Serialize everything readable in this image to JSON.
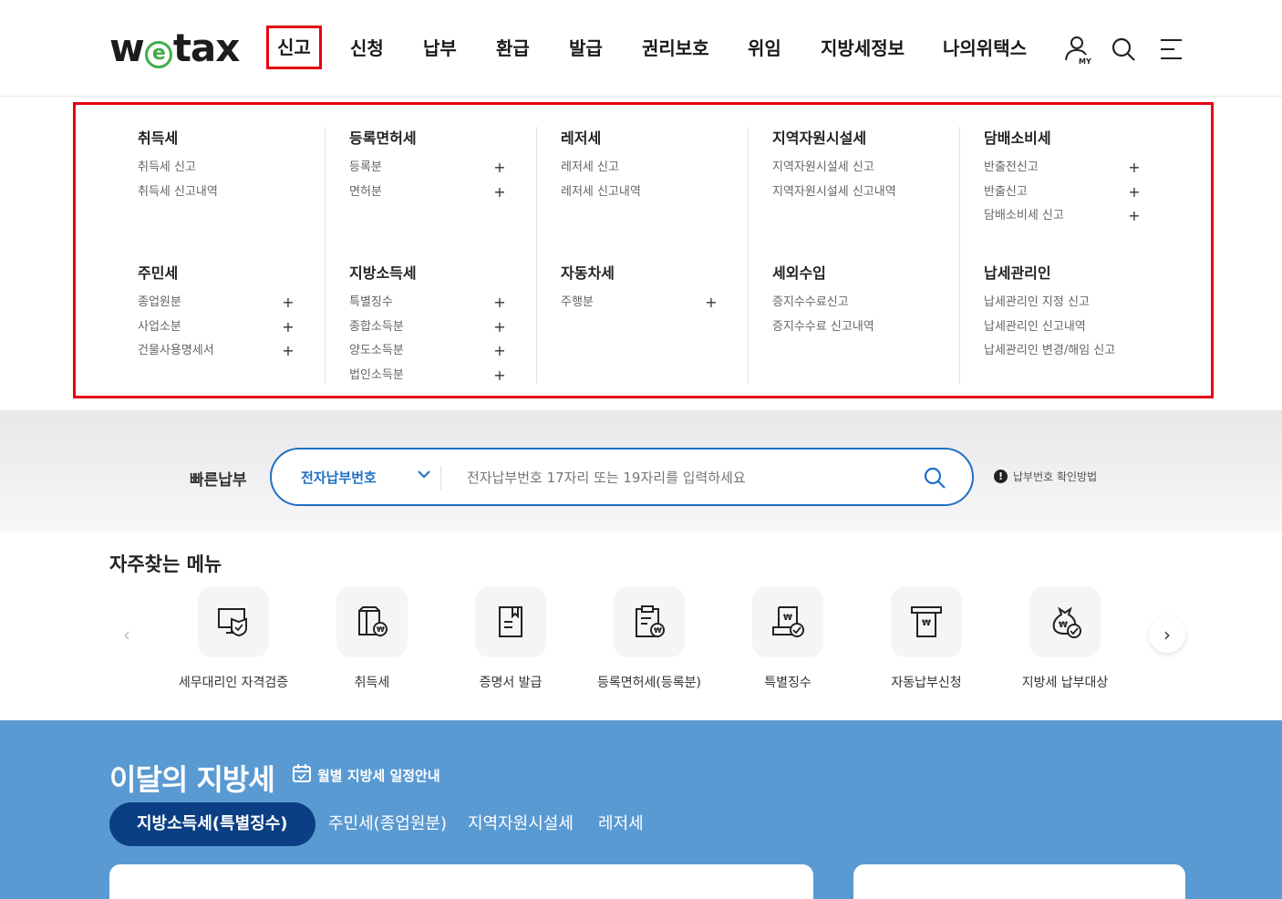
{
  "header": {
    "logo": {
      "pre": "w",
      "mid": "e",
      "post": "tax"
    },
    "nav": [
      {
        "label": "신고",
        "active": true
      },
      {
        "label": "신청"
      },
      {
        "label": "납부"
      },
      {
        "label": "환급"
      },
      {
        "label": "발급"
      },
      {
        "label": "권리보호"
      },
      {
        "label": "위임"
      },
      {
        "label": "지방세정보"
      },
      {
        "label": "나의위택스"
      }
    ],
    "icons": [
      "my-user-icon",
      "search-icon",
      "menu-icon"
    ],
    "my_label": "MY"
  },
  "mega_menu": {
    "groups": [
      {
        "title": "취득세",
        "items": [
          {
            "label": "취득세 신고"
          },
          {
            "label": "취득세 신고내역"
          }
        ]
      },
      {
        "title": "등록면허세",
        "items": [
          {
            "label": "등록분",
            "expand": true
          },
          {
            "label": "면허분",
            "expand": true
          }
        ]
      },
      {
        "title": "레저세",
        "items": [
          {
            "label": "레저세 신고"
          },
          {
            "label": "레저세 신고내역"
          }
        ]
      },
      {
        "title": "지역자원시설세",
        "items": [
          {
            "label": "지역자원시설세 신고"
          },
          {
            "label": "지역자원시설세 신고내역"
          }
        ]
      },
      {
        "title": "담배소비세",
        "items": [
          {
            "label": "반출전신고",
            "expand": true
          },
          {
            "label": "반출신고",
            "expand": true
          },
          {
            "label": "담배소비세 신고",
            "expand": true
          }
        ]
      },
      {
        "title": "주민세",
        "items": [
          {
            "label": "종업원분",
            "expand": true
          },
          {
            "label": "사업소분",
            "expand": true
          },
          {
            "label": "건물사용명세서",
            "expand": true
          }
        ]
      },
      {
        "title": "지방소득세",
        "items": [
          {
            "label": "특별징수",
            "expand": true
          },
          {
            "label": "종합소득분",
            "expand": true
          },
          {
            "label": "양도소득분",
            "expand": true
          },
          {
            "label": "법인소득분",
            "expand": true
          }
        ]
      },
      {
        "title": "자동차세",
        "items": [
          {
            "label": "주행분",
            "expand": true
          }
        ]
      },
      {
        "title": "세외수입",
        "items": [
          {
            "label": "증지수수료신고"
          },
          {
            "label": "증지수수료 신고내역"
          }
        ]
      },
      {
        "title": "납세관리인",
        "items": [
          {
            "label": "납세관리인 지정 신고"
          },
          {
            "label": "납세관리인 신고내역"
          },
          {
            "label": "납세관리인 변경/해임 신고"
          }
        ]
      }
    ],
    "plus_symbol": "+"
  },
  "quick_pay": {
    "label": "빠른납부",
    "select_value": "전자납부번호",
    "placeholder": "전자납부번호 17자리 또는 19자리를 입력하세요",
    "help_text": "납부번호 확인방법",
    "help_mark": "!"
  },
  "frequent": {
    "title": "자주찾는 메뉴",
    "prev": "‹",
    "next": "›",
    "items": [
      {
        "label": "세무대리인 자격검증",
        "icon": "monitor-shield-icon"
      },
      {
        "label": "취득세",
        "icon": "box-coin-icon"
      },
      {
        "label": "증명서 발급",
        "icon": "document-bookmark-icon"
      },
      {
        "label": "등록면허세(등록분)",
        "icon": "clipboard-coin-icon"
      },
      {
        "label": "특별징수",
        "icon": "document-check-icon"
      },
      {
        "label": "자동납부신청",
        "icon": "atm-bill-icon"
      },
      {
        "label": "지방세 납부대상",
        "icon": "money-bag-check-icon"
      }
    ]
  },
  "monthly": {
    "title": "이달의 지방세",
    "schedule_label": "월별 지방세 일정안내",
    "tabs": [
      {
        "label": "지방소득세(특별징수)",
        "active": true
      },
      {
        "label": "주민세(종업원분)"
      },
      {
        "label": "지역자원시설세"
      },
      {
        "label": "레저세"
      }
    ]
  },
  "colors": {
    "accent_blue": "#1f6fc4",
    "highlight_red": "#e60012",
    "logo_green": "#3fae49",
    "monthly_bg": "#5a9ad2",
    "active_tab": "#0b3f84"
  }
}
